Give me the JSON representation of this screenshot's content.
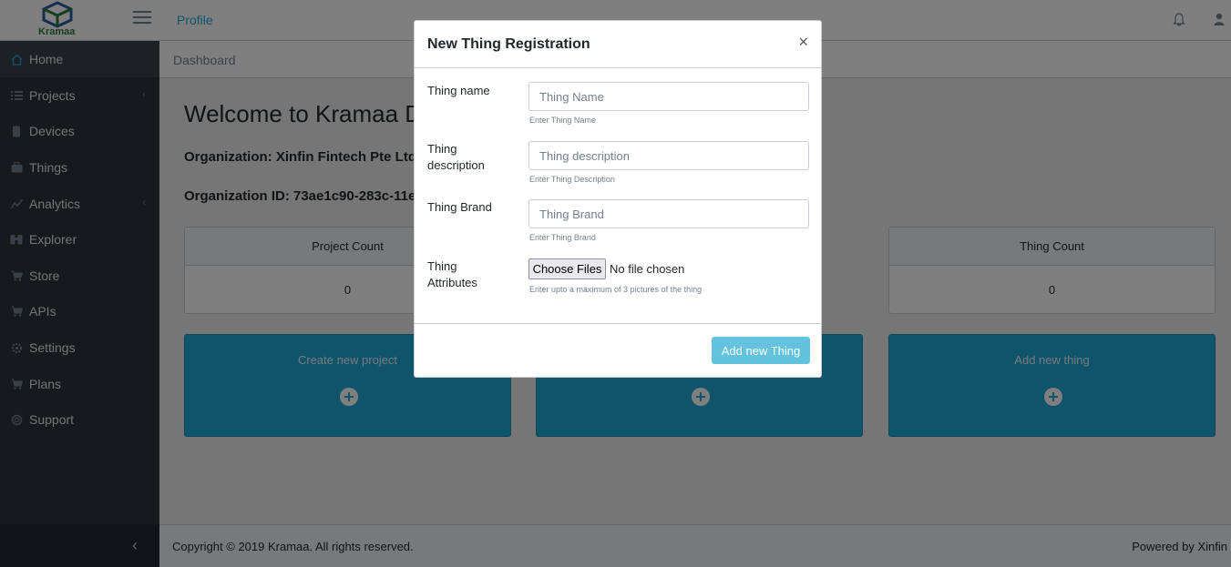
{
  "header": {
    "logo_text": "Kramaa",
    "nav_profile": "Profile"
  },
  "sidebar": {
    "items": [
      {
        "label": "Home",
        "icon": "home-icon",
        "active": true
      },
      {
        "label": "Projects",
        "icon": "list-icon",
        "caret": "‹"
      },
      {
        "label": "Devices",
        "icon": "device-icon"
      },
      {
        "label": "Things",
        "icon": "briefcase-icon"
      },
      {
        "label": "Analytics",
        "icon": "chart-icon",
        "caret": "‹"
      },
      {
        "label": "Explorer",
        "icon": "binoculars-icon"
      },
      {
        "label": "Store",
        "icon": "cart-icon"
      },
      {
        "label": "APIs",
        "icon": "cart-icon"
      },
      {
        "label": "Settings",
        "icon": "gear-icon"
      },
      {
        "label": "Plans",
        "icon": "cart-icon"
      },
      {
        "label": "Support",
        "icon": "lifebuoy-icon"
      }
    ],
    "toggle": "‹"
  },
  "breadcrumb": "Dashboard",
  "main": {
    "welcome": "Welcome to Kramaa D",
    "org_name": "Organization: Xinfin Fintech Pte Ltd",
    "org_id": "Organization ID: 73ae1c90-283c-11e",
    "cards": [
      {
        "title": "Project Count",
        "value": "0"
      },
      {
        "title": "Thing Count",
        "value": "0"
      }
    ],
    "actions": [
      {
        "label": "Create new project"
      },
      {
        "label": ""
      },
      {
        "label": "Add new thing"
      }
    ]
  },
  "footer": {
    "copyright": "Copyright © 2019 Kramaa. All rights reserved.",
    "powered": "Powered by Xinfin"
  },
  "modal": {
    "title": "New Thing Registration",
    "close": "×",
    "fields": [
      {
        "label": "Thing name",
        "placeholder": "Thing Name",
        "help": "Enter Thing Name"
      },
      {
        "label": "Thing description",
        "placeholder": "Thing description",
        "help": "Enter Thing Description"
      },
      {
        "label": "Thing Brand",
        "placeholder": "Thing Brand",
        "help": "Enter Thing Brand"
      }
    ],
    "attributes": {
      "label": "Thing Attributes",
      "button": "Choose Files",
      "status": "No file chosen",
      "help": "Enter upto a maximum of 3 pictures of the thing"
    },
    "submit": "Add new Thing"
  },
  "colors": {
    "primary": "#20a8d8",
    "sidebar": "#2f353a",
    "submit": "#63c2de"
  }
}
